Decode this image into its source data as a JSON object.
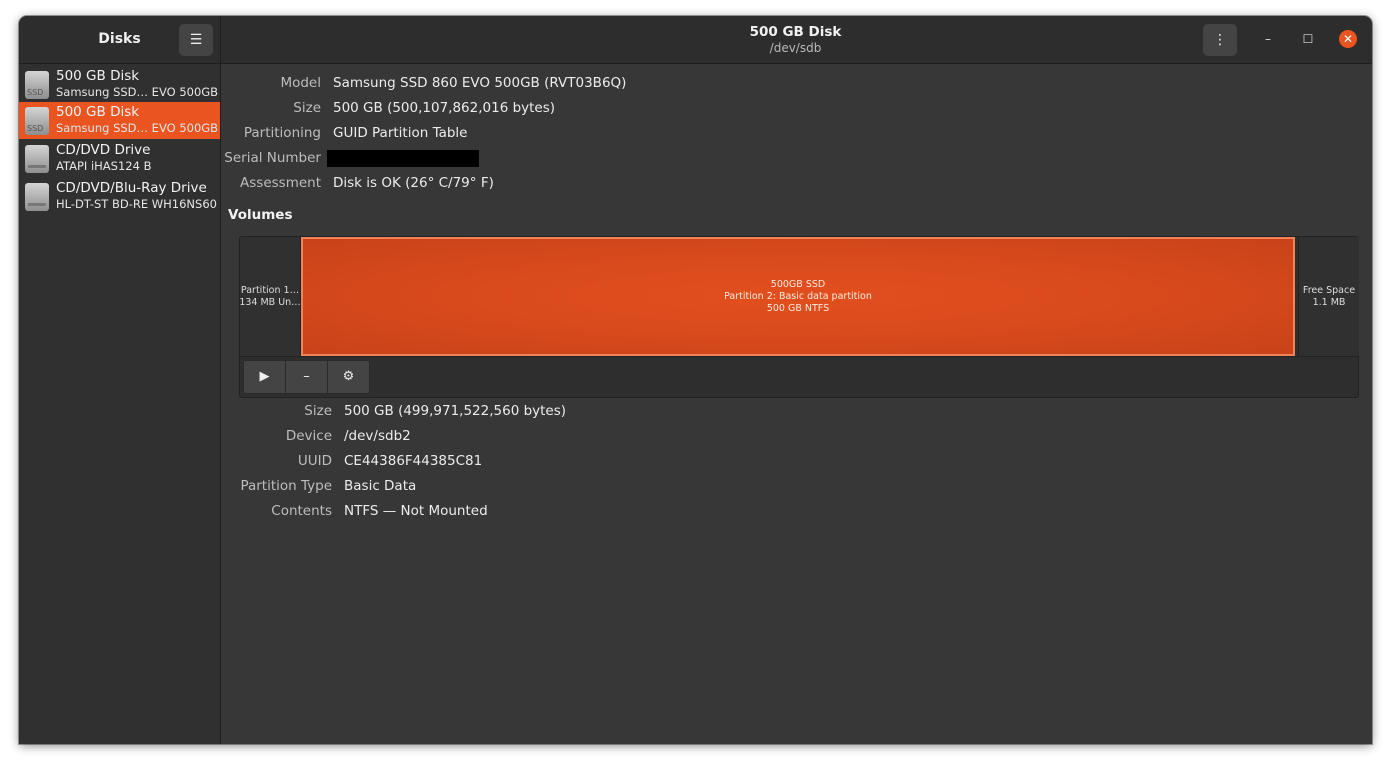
{
  "window": {
    "title": "500 GB Disk",
    "subtitle": "/dev/sdb"
  },
  "sidebar": {
    "title": "Disks",
    "items": [
      {
        "name": "500 GB Disk",
        "model": "Samsung SSD… EVO 500GB",
        "icon": "ssd-drive-icon",
        "icon_label": "SSD",
        "selected": false
      },
      {
        "name": "500 GB Disk",
        "model": "Samsung SSD… EVO 500GB",
        "icon": "ssd-drive-icon",
        "icon_label": "SSD",
        "selected": true
      },
      {
        "name": "CD/DVD Drive",
        "model": "ATAPI   iHAS124   B",
        "icon": "optical-drive-icon",
        "selected": false
      },
      {
        "name": "CD/DVD/Blu-Ray Drive",
        "model": "HL-DT-ST BD-RE  WH16NS60",
        "icon": "optical-drive-icon",
        "selected": false
      }
    ]
  },
  "header_buttons": {
    "menu_icon": "☰",
    "kebab_icon": "⋮",
    "minimize": "–",
    "maximize": "☐",
    "close": "✕"
  },
  "disk_info": {
    "model_label": "Model",
    "model": "Samsung SSD 860 EVO 500GB (RVT03B6Q)",
    "size_label": "Size",
    "size": "500 GB (500,107,862,016 bytes)",
    "partitioning_label": "Partitioning",
    "partitioning": "GUID Partition Table",
    "serial_label": "Serial Number",
    "serial_redacted": true,
    "assessment_label": "Assessment",
    "assessment": "Disk is OK (26° C/79° F)"
  },
  "volumes": {
    "heading": "Volumes",
    "segments": [
      {
        "line1": "Partition 1…",
        "line2": "134 MB Un…"
      },
      {
        "line1": "500GB SSD",
        "line2": "Partition 2: Basic data partition",
        "line3": "500 GB NTFS",
        "selected": true
      },
      {
        "line1": "Free Space",
        "line2": "1.1 MB"
      }
    ],
    "toolbar": {
      "mount_icon": "▶",
      "delete_icon": "–",
      "settings_icon": "⚙"
    }
  },
  "partition_info": {
    "size_label": "Size",
    "size": "500 GB (499,971,522,560 bytes)",
    "device_label": "Device",
    "device": "/dev/sdb2",
    "uuid_label": "UUID",
    "uuid": "CE44386F44385C81",
    "type_label": "Partition Type",
    "type": "Basic Data",
    "contents_label": "Contents",
    "contents": "NTFS — Not Mounted"
  },
  "colors": {
    "accent": "#e95420",
    "window_bg": "#373737",
    "sidebar_bg": "#303030",
    "headerbar_bg": "#2d2d2d"
  }
}
